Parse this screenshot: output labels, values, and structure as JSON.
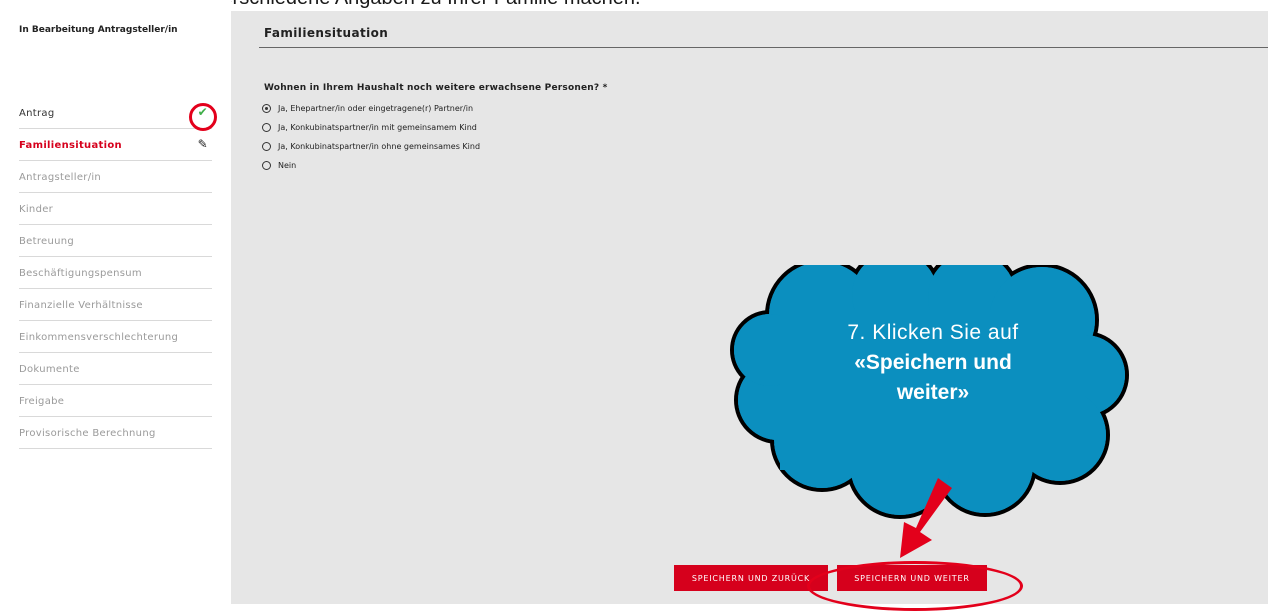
{
  "caption": "Als erstes müssen Sie verschiedene Angaben zu Ihrer Familie machen.",
  "status": "In Bearbeitung Antragsteller/in",
  "nav": [
    {
      "label": "Antrag",
      "state": "done",
      "icon": "check-icon"
    },
    {
      "label": "Familiensituation",
      "state": "active",
      "icon": "pencil-icon"
    },
    {
      "label": "Antragsteller/in",
      "state": "pending"
    },
    {
      "label": "Kinder",
      "state": "pending"
    },
    {
      "label": "Betreuung",
      "state": "pending"
    },
    {
      "label": "Beschäftigungspensum",
      "state": "pending"
    },
    {
      "label": "Finanzielle Verhältnisse",
      "state": "pending"
    },
    {
      "label": "Einkommensverschlechterung",
      "state": "pending"
    },
    {
      "label": "Dokumente",
      "state": "pending"
    },
    {
      "label": "Freigabe",
      "state": "pending"
    },
    {
      "label": "Provisorische Berechnung",
      "state": "pending"
    }
  ],
  "page_title": "Familiensituation",
  "question": "Wohnen in Ihrem Haushalt noch weitere erwachsene Personen? *",
  "options": [
    {
      "label": "Ja, Ehepartner/in oder eingetragene(r) Partner/in",
      "selected": true
    },
    {
      "label": "Ja, Konkubinatspartner/in mit gemeinsamem Kind",
      "selected": false
    },
    {
      "label": "Ja, Konkubinatspartner/in ohne gemeinsames Kind",
      "selected": false
    },
    {
      "label": "Nein",
      "selected": false
    }
  ],
  "buttons": {
    "back": "SPEICHERN UND ZURÜCK",
    "next": "SPEICHERN UND WEITER"
  },
  "callout": {
    "line1": "7. Klicken Sie auf",
    "line2": "«Speichern und",
    "line3": "weiter»"
  },
  "colors": {
    "accent_red": "#d6001c",
    "cloud_blue": "#0b8fbf",
    "check_green": "#3fae49",
    "content_bg": "#e6e6e6"
  }
}
